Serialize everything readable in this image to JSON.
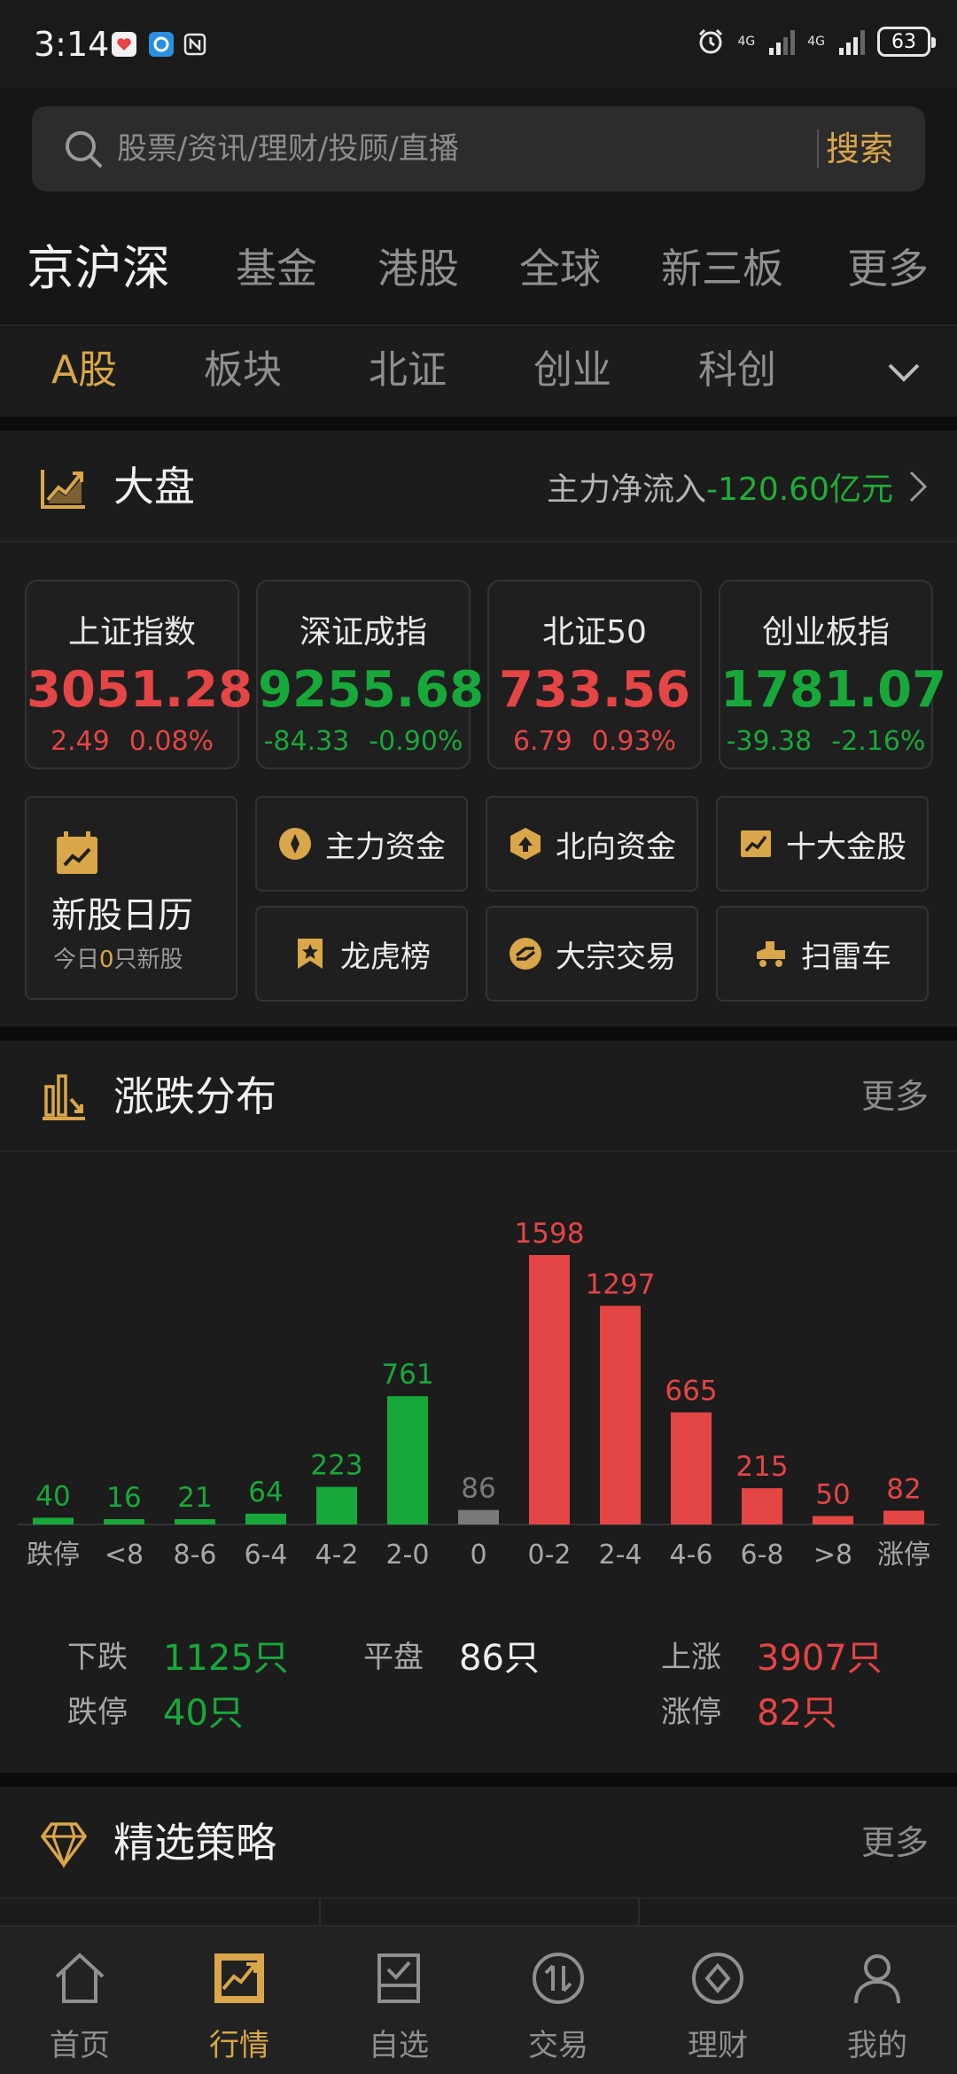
{
  "status_bar": {
    "time": "3:14",
    "network1": "4G",
    "network2": "4G",
    "battery": "63"
  },
  "search": {
    "placeholder": "股票/资讯/理财/投顾/直播",
    "button": "搜索"
  },
  "market_tabs": [
    "京沪深",
    "基金",
    "港股",
    "全球",
    "新三板",
    "更多"
  ],
  "sub_tabs": [
    "A股",
    "板块",
    "北证",
    "创业",
    "科创"
  ],
  "dapan": {
    "title": "大盘",
    "flow_label": "主力净流入",
    "flow_value": "-120.60亿元",
    "indices": [
      {
        "name": "上证指数",
        "price": "3051.28",
        "change": "2.49",
        "pct": "0.08%",
        "trend": "up"
      },
      {
        "name": "深证成指",
        "price": "9255.68",
        "change": "-84.33",
        "pct": "-0.90%",
        "trend": "down"
      },
      {
        "name": "北证50",
        "price": "733.56",
        "change": "6.79",
        "pct": "0.93%",
        "trend": "up"
      },
      {
        "name": "创业板指",
        "price": "1781.07",
        "change": "-39.38",
        "pct": "-2.16%",
        "trend": "down"
      }
    ]
  },
  "tools": {
    "ipo_title": "新股日历",
    "ipo_sub_pre": "今日",
    "ipo_count": "0",
    "ipo_sub_post": "只新股",
    "items": [
      "主力资金",
      "北向资金",
      "十大金股",
      "龙虎榜",
      "大宗交易",
      "扫雷车"
    ]
  },
  "distribution": {
    "title": "涨跌分布",
    "more": "更多",
    "stats": {
      "down_label": "下跌",
      "down_value": "1125只",
      "flat_label": "平盘",
      "flat_value": "86只",
      "up_label": "上涨",
      "up_value": "3907只",
      "limit_down_label": "跌停",
      "limit_down_value": "40只",
      "limit_up_label": "涨停",
      "limit_up_value": "82只"
    }
  },
  "chart_data": {
    "type": "bar",
    "categories": [
      "跌停",
      "<8",
      "8-6",
      "6-4",
      "4-2",
      "2-0",
      "0",
      "0-2",
      "2-4",
      "4-6",
      "6-8",
      ">8",
      "涨停"
    ],
    "values": [
      40,
      16,
      21,
      64,
      223,
      761,
      86,
      1598,
      1297,
      665,
      215,
      50,
      82
    ],
    "colors": [
      "green",
      "green",
      "green",
      "green",
      "green",
      "green",
      "gray",
      "red",
      "red",
      "red",
      "red",
      "red",
      "red"
    ],
    "title": "",
    "xlabel": "",
    "ylabel": "",
    "ylim": [
      0,
      1598
    ]
  },
  "strategy": {
    "title": "精选策略",
    "more": "更多"
  },
  "bottom_nav": [
    "首页",
    "行情",
    "自选",
    "交易",
    "理财",
    "我的"
  ],
  "colors": {
    "accent": "#d9a64a",
    "up": "#e44545",
    "down": "#18a83a",
    "flat": "#7a7a7a"
  }
}
